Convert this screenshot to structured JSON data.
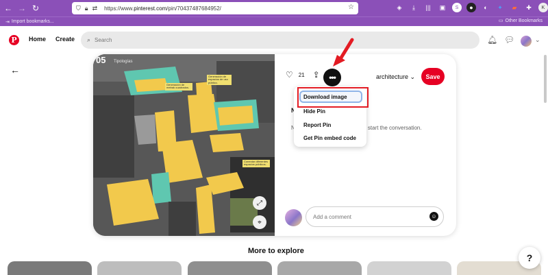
{
  "browser": {
    "url_prefix": "https://www.",
    "url_domain": "pinterest.com",
    "url_path": "/pin/70437487684952/",
    "import_bookmarks": "Import bookmarks...",
    "other_bookmarks": "Other Bookmarks"
  },
  "header": {
    "logo": "P",
    "home": "Home",
    "create": "Create",
    "search_placeholder": "Search"
  },
  "pin": {
    "image_number": "05",
    "image_subtitle": "Tipologías",
    "annotations": [
      "Generación de metrak cuadrados.",
      "Generación de espacios de uso público.",
      "Conectar diferentes espacios públicos."
    ],
    "likes": "21",
    "board": "architecture",
    "save": "Save",
    "comments_heading": "No",
    "comments_empty_left": "No",
    "comments_empty_right": "to start the conversation.",
    "comment_placeholder": "Add a comment"
  },
  "menu": {
    "items": [
      "Download image",
      "Hide Pin",
      "Report Pin",
      "Get Pin embed code"
    ]
  },
  "explore": {
    "title": "More to explore"
  },
  "help": "?",
  "colors": {
    "browser_purple": "#8b50b8",
    "pinterest_red": "#e60023",
    "highlight_red": "#e31b23",
    "accent_yellow": "#f2c94c",
    "accent_teal": "#5fc7b0"
  }
}
